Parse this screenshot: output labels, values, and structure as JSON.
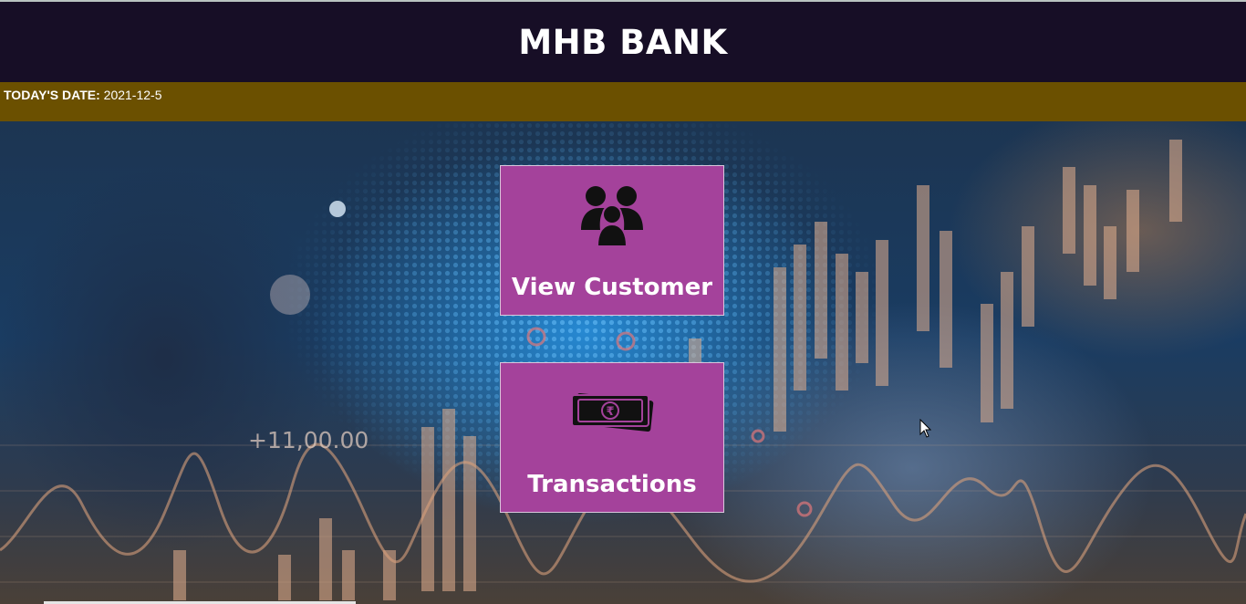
{
  "header": {
    "title": "MHB BANK"
  },
  "datebar": {
    "label": "TODAY'S DATE:",
    "value": "2021-12-5"
  },
  "background": {
    "overlay_text": "+11,00.00"
  },
  "tiles": [
    {
      "label": "View Customer",
      "icon": "customers-group-icon"
    },
    {
      "label": "Transactions",
      "icon": "rupee-banknotes-icon"
    }
  ],
  "colors": {
    "header_bg": "#170e26",
    "datebar_bg": "#6b5000",
    "tile_bg": "#a4429b"
  }
}
